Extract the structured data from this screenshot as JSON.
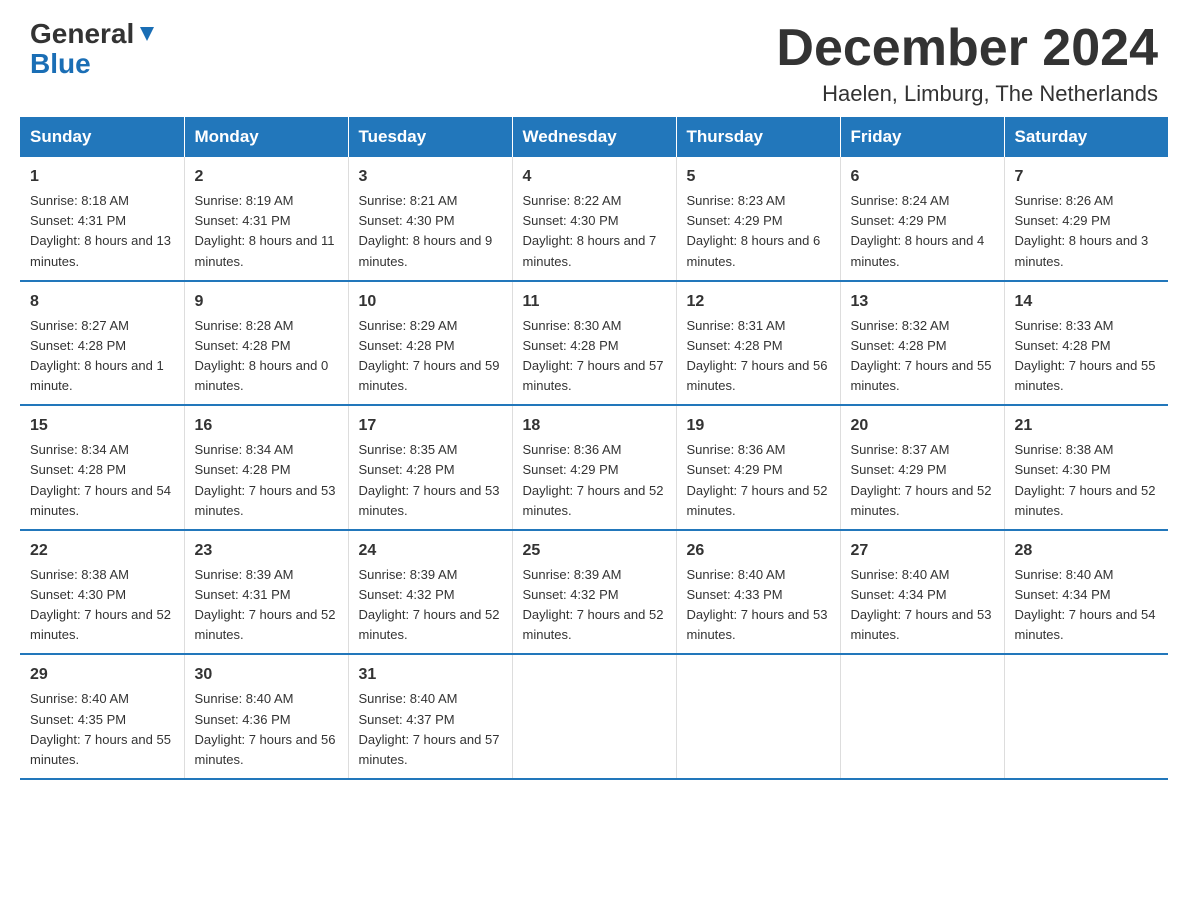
{
  "header": {
    "logo_general": "General",
    "logo_blue": "Blue",
    "month_year": "December 2024",
    "location": "Haelen, Limburg, The Netherlands"
  },
  "days_of_week": [
    "Sunday",
    "Monday",
    "Tuesday",
    "Wednesday",
    "Thursday",
    "Friday",
    "Saturday"
  ],
  "weeks": [
    [
      {
        "day": "1",
        "sunrise": "8:18 AM",
        "sunset": "4:31 PM",
        "daylight": "8 hours and 13 minutes."
      },
      {
        "day": "2",
        "sunrise": "8:19 AM",
        "sunset": "4:31 PM",
        "daylight": "8 hours and 11 minutes."
      },
      {
        "day": "3",
        "sunrise": "8:21 AM",
        "sunset": "4:30 PM",
        "daylight": "8 hours and 9 minutes."
      },
      {
        "day": "4",
        "sunrise": "8:22 AM",
        "sunset": "4:30 PM",
        "daylight": "8 hours and 7 minutes."
      },
      {
        "day": "5",
        "sunrise": "8:23 AM",
        "sunset": "4:29 PM",
        "daylight": "8 hours and 6 minutes."
      },
      {
        "day": "6",
        "sunrise": "8:24 AM",
        "sunset": "4:29 PM",
        "daylight": "8 hours and 4 minutes."
      },
      {
        "day": "7",
        "sunrise": "8:26 AM",
        "sunset": "4:29 PM",
        "daylight": "8 hours and 3 minutes."
      }
    ],
    [
      {
        "day": "8",
        "sunrise": "8:27 AM",
        "sunset": "4:28 PM",
        "daylight": "8 hours and 1 minute."
      },
      {
        "day": "9",
        "sunrise": "8:28 AM",
        "sunset": "4:28 PM",
        "daylight": "8 hours and 0 minutes."
      },
      {
        "day": "10",
        "sunrise": "8:29 AM",
        "sunset": "4:28 PM",
        "daylight": "7 hours and 59 minutes."
      },
      {
        "day": "11",
        "sunrise": "8:30 AM",
        "sunset": "4:28 PM",
        "daylight": "7 hours and 57 minutes."
      },
      {
        "day": "12",
        "sunrise": "8:31 AM",
        "sunset": "4:28 PM",
        "daylight": "7 hours and 56 minutes."
      },
      {
        "day": "13",
        "sunrise": "8:32 AM",
        "sunset": "4:28 PM",
        "daylight": "7 hours and 55 minutes."
      },
      {
        "day": "14",
        "sunrise": "8:33 AM",
        "sunset": "4:28 PM",
        "daylight": "7 hours and 55 minutes."
      }
    ],
    [
      {
        "day": "15",
        "sunrise": "8:34 AM",
        "sunset": "4:28 PM",
        "daylight": "7 hours and 54 minutes."
      },
      {
        "day": "16",
        "sunrise": "8:34 AM",
        "sunset": "4:28 PM",
        "daylight": "7 hours and 53 minutes."
      },
      {
        "day": "17",
        "sunrise": "8:35 AM",
        "sunset": "4:28 PM",
        "daylight": "7 hours and 53 minutes."
      },
      {
        "day": "18",
        "sunrise": "8:36 AM",
        "sunset": "4:29 PM",
        "daylight": "7 hours and 52 minutes."
      },
      {
        "day": "19",
        "sunrise": "8:36 AM",
        "sunset": "4:29 PM",
        "daylight": "7 hours and 52 minutes."
      },
      {
        "day": "20",
        "sunrise": "8:37 AM",
        "sunset": "4:29 PM",
        "daylight": "7 hours and 52 minutes."
      },
      {
        "day": "21",
        "sunrise": "8:38 AM",
        "sunset": "4:30 PM",
        "daylight": "7 hours and 52 minutes."
      }
    ],
    [
      {
        "day": "22",
        "sunrise": "8:38 AM",
        "sunset": "4:30 PM",
        "daylight": "7 hours and 52 minutes."
      },
      {
        "day": "23",
        "sunrise": "8:39 AM",
        "sunset": "4:31 PM",
        "daylight": "7 hours and 52 minutes."
      },
      {
        "day": "24",
        "sunrise": "8:39 AM",
        "sunset": "4:32 PM",
        "daylight": "7 hours and 52 minutes."
      },
      {
        "day": "25",
        "sunrise": "8:39 AM",
        "sunset": "4:32 PM",
        "daylight": "7 hours and 52 minutes."
      },
      {
        "day": "26",
        "sunrise": "8:40 AM",
        "sunset": "4:33 PM",
        "daylight": "7 hours and 53 minutes."
      },
      {
        "day": "27",
        "sunrise": "8:40 AM",
        "sunset": "4:34 PM",
        "daylight": "7 hours and 53 minutes."
      },
      {
        "day": "28",
        "sunrise": "8:40 AM",
        "sunset": "4:34 PM",
        "daylight": "7 hours and 54 minutes."
      }
    ],
    [
      {
        "day": "29",
        "sunrise": "8:40 AM",
        "sunset": "4:35 PM",
        "daylight": "7 hours and 55 minutes."
      },
      {
        "day": "30",
        "sunrise": "8:40 AM",
        "sunset": "4:36 PM",
        "daylight": "7 hours and 56 minutes."
      },
      {
        "day": "31",
        "sunrise": "8:40 AM",
        "sunset": "4:37 PM",
        "daylight": "7 hours and 57 minutes."
      },
      null,
      null,
      null,
      null
    ]
  ],
  "labels": {
    "sunrise": "Sunrise:",
    "sunset": "Sunset:",
    "daylight": "Daylight:"
  }
}
